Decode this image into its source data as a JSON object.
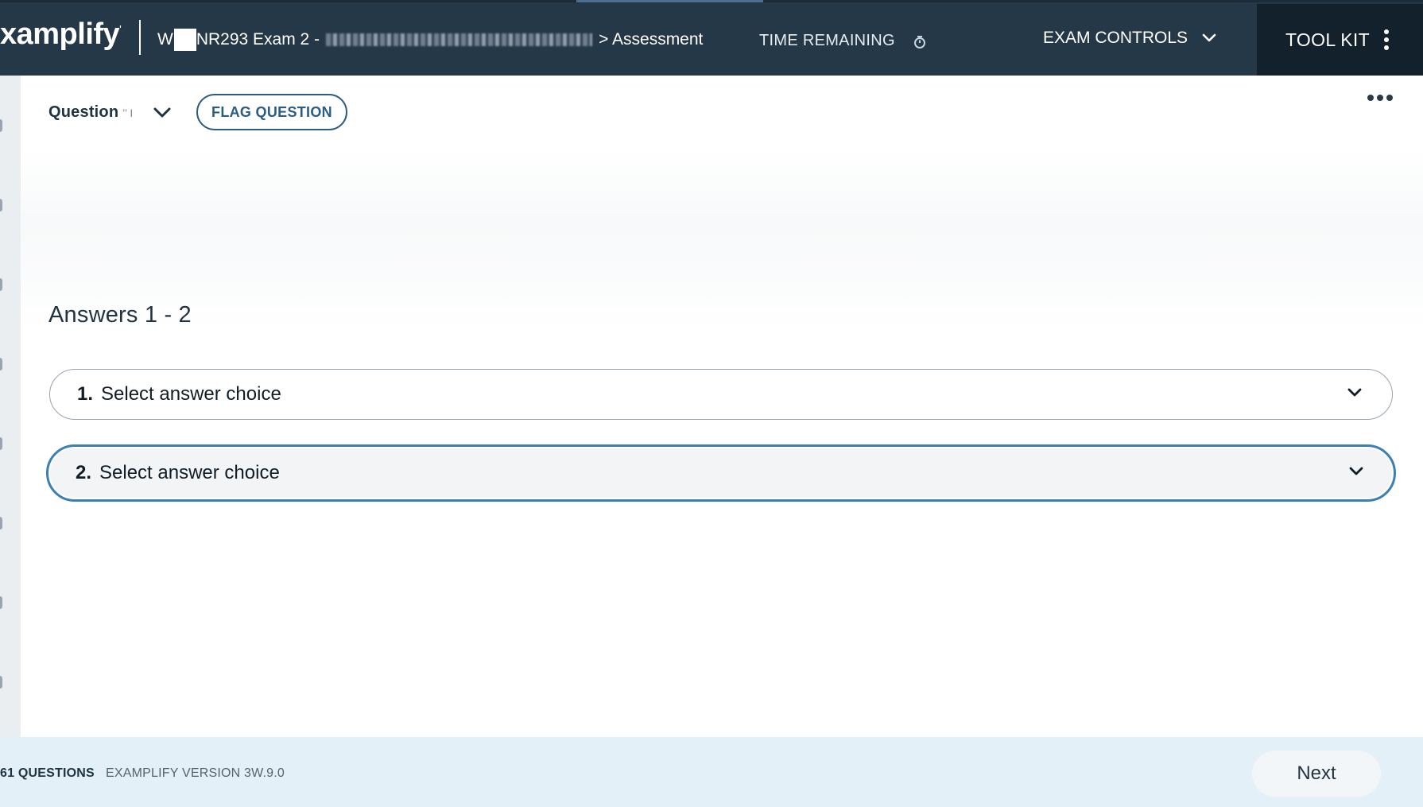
{
  "header": {
    "logo_text": "xamplify",
    "logo_mark": "'",
    "breadcrumb_prefix": "W",
    "breadcrumb_course": "NR293 Exam 2 -",
    "breadcrumb_section": "> Assessment",
    "timer_label": "TIME REMAINING",
    "exam_controls_label": "EXAM CONTROLS",
    "toolkit_label": "TOOL KIT"
  },
  "question_bar": {
    "question_label": "Question",
    "question_number": " ’’ I",
    "flag_label": "FLAG QUESTION"
  },
  "answers": {
    "heading": "Answers 1 - 2",
    "items": [
      {
        "number": "1.",
        "placeholder": "Select answer choice"
      },
      {
        "number": "2.",
        "placeholder": "Select answer choice"
      }
    ]
  },
  "footer": {
    "questions_count": "61 QUESTIONS",
    "version": "EXAMPLIFY VERSION 3W.9.0",
    "next_label": "Next"
  },
  "icons": {
    "timer": "clock-icon",
    "exam_controls": "chevron-down-icon",
    "toolkit": "kebab-menu-icon",
    "more": "more-horizontal-icon",
    "dropdown": "chevron-down-icon"
  },
  "colors": {
    "header_bg": "#253848",
    "toolkit_bg": "#13212d",
    "accent_blue": "#2b5c84",
    "focus_ring": "#3c7fb3",
    "footer_bg": "#e3f0f8"
  }
}
